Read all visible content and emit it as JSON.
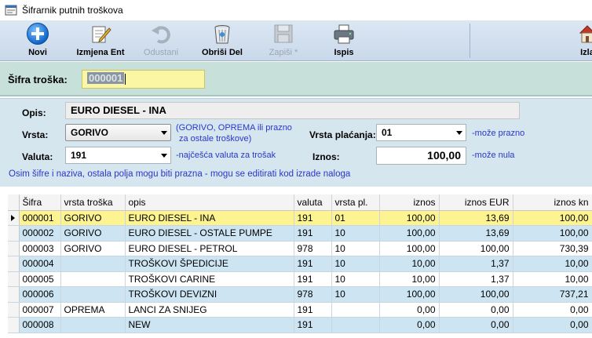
{
  "window": {
    "title": "Šifrarnik putnih troškova"
  },
  "toolbar": {
    "new_label": "Novi",
    "edit_label": "Izmjena Ent",
    "cancel_label": "Odustani",
    "delete_label": "Obriši Del",
    "save_label": "Zapiši *",
    "print_label": "Ispis",
    "exit_label": "Izla"
  },
  "sifra": {
    "label": "Šifra troška:",
    "value": "000001"
  },
  "form": {
    "opis_label": "Opis:",
    "opis_value": "EURO DIESEL - INA",
    "vrsta_label": "Vrsta:",
    "vrsta_value": "GORIVO",
    "vrsta_hint_line1": "(GORIVO, OPREMA ili prazno",
    "vrsta_hint_line2": "za ostale troškove)",
    "vrsta_placanja_label": "Vrsta plaćanja:",
    "vrsta_placanja_value": "01",
    "vrsta_placanja_hint": "-može prazno",
    "valuta_label": "Valuta:",
    "valuta_value": "191",
    "valuta_hint": "-najčešća valuta za trošak",
    "iznos_label": "Iznos:",
    "iznos_value": "100,00",
    "iznos_hint": "-može nula",
    "note": "Osim šifre i naziva, ostala polja mogu biti prazna - mogu se editirati kod izrade naloga"
  },
  "grid": {
    "columns": [
      "Šifra",
      "vrsta troška",
      "opis",
      "valuta",
      "vrsta pl.",
      "iznos",
      "iznos EUR",
      "iznos kn"
    ],
    "rows": [
      [
        "000001",
        "GORIVO",
        "EURO DIESEL - INA",
        "191",
        "01",
        "100,00",
        "13,69",
        "100,00"
      ],
      [
        "000002",
        "GORIVO",
        "EURO DIESEL - OSTALE PUMPE",
        "191",
        "10",
        "100,00",
        "13,69",
        "100,00"
      ],
      [
        "000003",
        "GORIVO",
        "EURO DIESEL - PETROL",
        "978",
        "10",
        "100,00",
        "100,00",
        "730,39"
      ],
      [
        "000004",
        "",
        "TROŠKOVI ŠPEDICIJE",
        "191",
        "10",
        "10,00",
        "1,37",
        "10,00"
      ],
      [
        "000005",
        "",
        "TROŠKOVI CARINE",
        "191",
        "10",
        "10,00",
        "1,37",
        "10,00"
      ],
      [
        "000006",
        "",
        "TROŠKOVI DEVIZNI",
        "978",
        "10",
        "100,00",
        "100,00",
        "737,21"
      ],
      [
        "000007",
        "OPREMA",
        "LANCI ZA SNIJEG",
        "191",
        "",
        "0,00",
        "0,00",
        "0,00"
      ],
      [
        "000008",
        "",
        "NEW",
        "191",
        "",
        "0,00",
        "0,00",
        "0,00"
      ]
    ]
  },
  "colors": {
    "selected_row": "#fdf390",
    "blue_row": "#cde5f3",
    "hint_text": "#2a36c9",
    "panel_green": "#c7e0da",
    "panel_blue": "#d6e6ef"
  },
  "icons": [
    "app-icon",
    "add-icon",
    "edit-icon",
    "undo-icon",
    "trash-icon",
    "save-icon",
    "printer-icon",
    "exit-icon",
    "row-pointer-icon",
    "chevron-down-icon"
  ]
}
